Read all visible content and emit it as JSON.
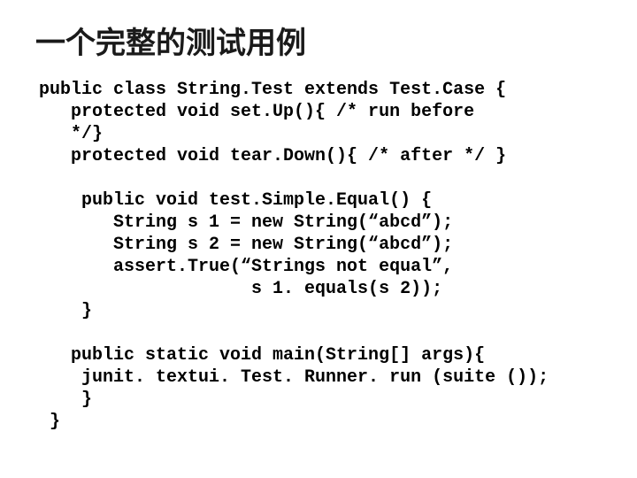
{
  "title": "一个完整的测试用例",
  "code": {
    "l01": "public class String.Test extends Test.Case {",
    "l02": "   protected void set.Up(){ /* run before",
    "l03": "   */}",
    "l04": "   protected void tear.Down(){ /* after */ }",
    "l05": "",
    "l06": "    public void test.Simple.Equal() {",
    "l07": "       String s 1 = new String(“abcd”);",
    "l08": "       String s 2 = new String(“abcd”);",
    "l09": "       assert.True(“Strings not equal”,",
    "l10": "                    s 1. equals(s 2));",
    "l11": "    }",
    "l12": "",
    "l13": "   public static void main(String[] args){",
    "l14": "    junit. textui. Test. Runner. run (suite ());",
    "l15": "    }",
    "l16": " }"
  }
}
